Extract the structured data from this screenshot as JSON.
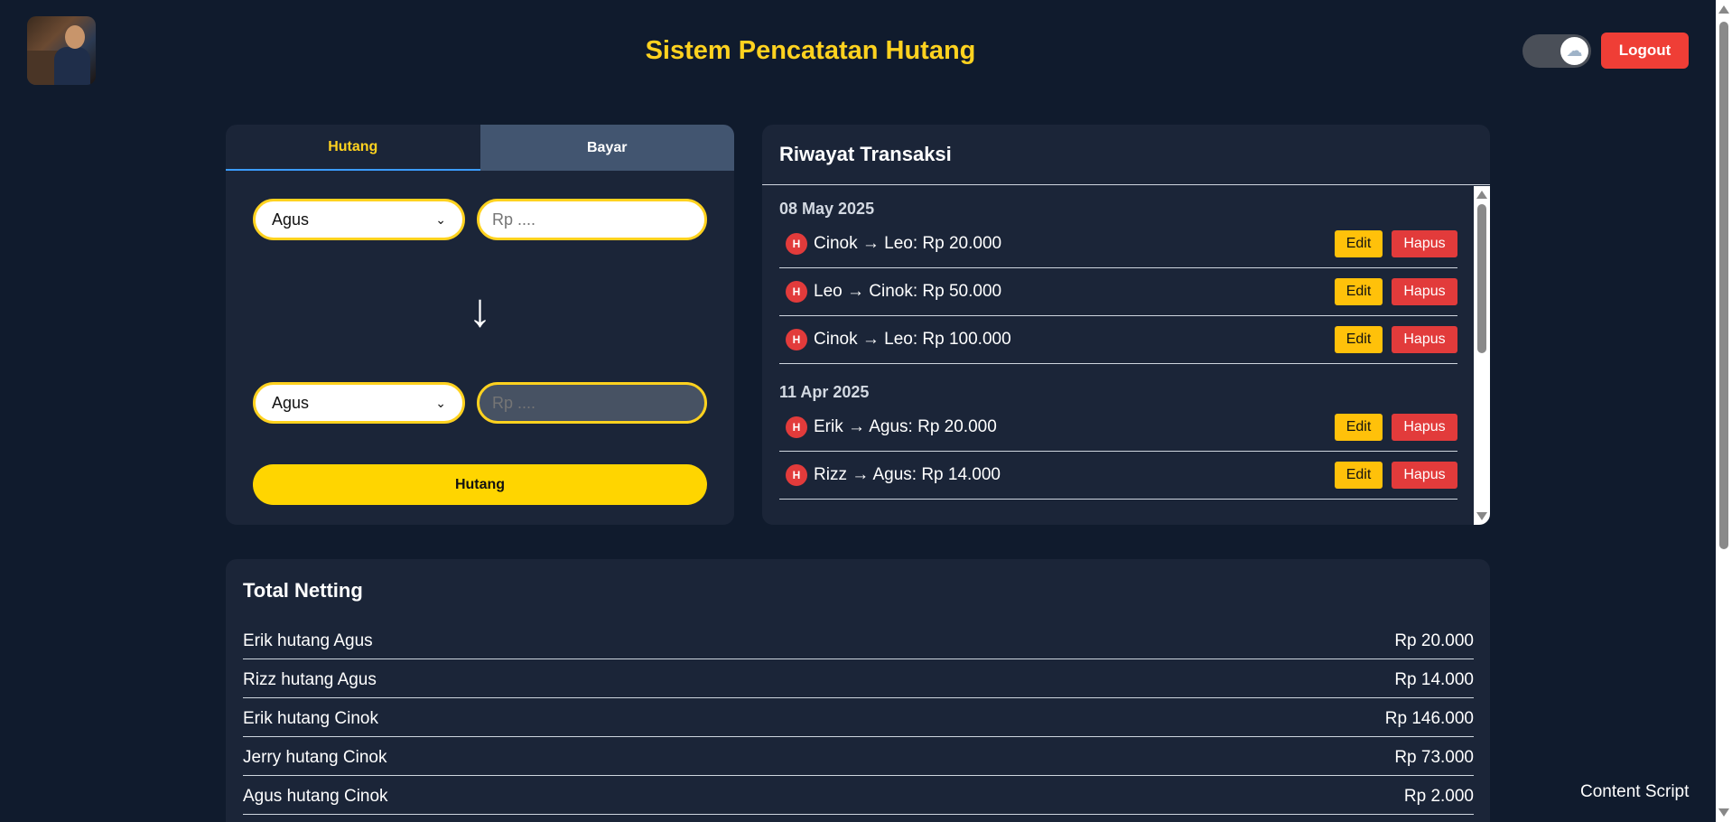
{
  "header": {
    "title": "Sistem Pencatatan Hutang",
    "theme_toggle_icon": "cloud-icon",
    "logout_label": "Logout"
  },
  "form": {
    "tabs": [
      {
        "label": "Hutang",
        "active": true
      },
      {
        "label": "Bayar",
        "active": false
      }
    ],
    "from_person": "Agus",
    "to_person": "Agus",
    "amount_placeholder": "Rp ....",
    "amount_value": "",
    "arrow_glyph": "↓",
    "submit_label": "Hutang"
  },
  "history": {
    "title": "Riwayat Transaksi",
    "groups": [
      {
        "date": "08 May 2025",
        "items": [
          {
            "badge": "H",
            "text": "Cinok → Leo: Rp 20.000"
          },
          {
            "badge": "H",
            "text": "Leo → Cinok: Rp 50.000"
          },
          {
            "badge": "H",
            "text": "Cinok → Leo: Rp 100.000"
          }
        ]
      },
      {
        "date": "11 Apr 2025",
        "items": [
          {
            "badge": "H",
            "text": "Erik → Agus: Rp 20.000"
          },
          {
            "badge": "H",
            "text": "Rizz → Agus: Rp 14.000"
          }
        ]
      }
    ],
    "edit_label": "Edit",
    "delete_label": "Hapus"
  },
  "netting": {
    "title": "Total Netting",
    "rows": [
      {
        "label": "Erik hutang Agus",
        "amount": "Rp 20.000"
      },
      {
        "label": "Rizz hutang Agus",
        "amount": "Rp 14.000"
      },
      {
        "label": "Erik hutang Cinok",
        "amount": "Rp 146.000"
      },
      {
        "label": "Jerry hutang Cinok",
        "amount": "Rp 73.000"
      },
      {
        "label": "Agus hutang Cinok",
        "amount": "Rp 2.000"
      }
    ]
  },
  "footer": {
    "content_script": "Content Script"
  },
  "colors": {
    "background": "#101b2d",
    "panel": "#1b2538",
    "accent": "#ffd21f",
    "danger": "#e23b3b",
    "edit": "#ffc10a"
  }
}
